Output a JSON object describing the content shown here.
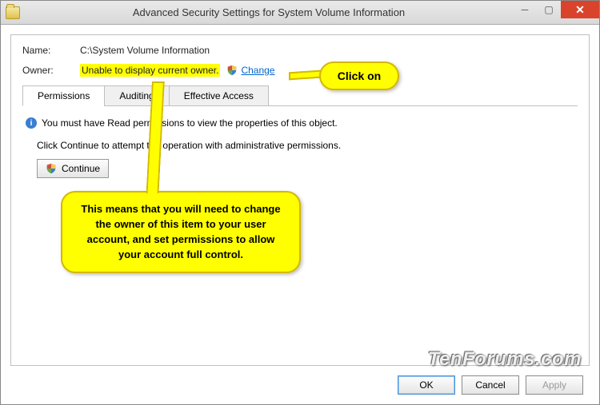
{
  "window": {
    "title": "Advanced Security Settings for System Volume Information"
  },
  "fields": {
    "name_label": "Name:",
    "name_value": "C:\\System Volume Information",
    "owner_label": "Owner:",
    "owner_value": "Unable to display current owner.",
    "change_link": "Change"
  },
  "tabs": {
    "permissions": "Permissions",
    "auditing": "Auditing",
    "effective": "Effective Access"
  },
  "messages": {
    "info": "You must have Read permissions to view the properties of this object.",
    "continue_hint": "Click Continue to attempt the operation with administrative permissions.",
    "continue_btn": "Continue"
  },
  "callouts": {
    "big": "This means that you will need to change the owner of this item to your user account, and set permissions to allow your account full control.",
    "small": "Click on"
  },
  "buttons": {
    "ok": "OK",
    "cancel": "Cancel",
    "apply": "Apply"
  },
  "watermark": "TenForums.com"
}
